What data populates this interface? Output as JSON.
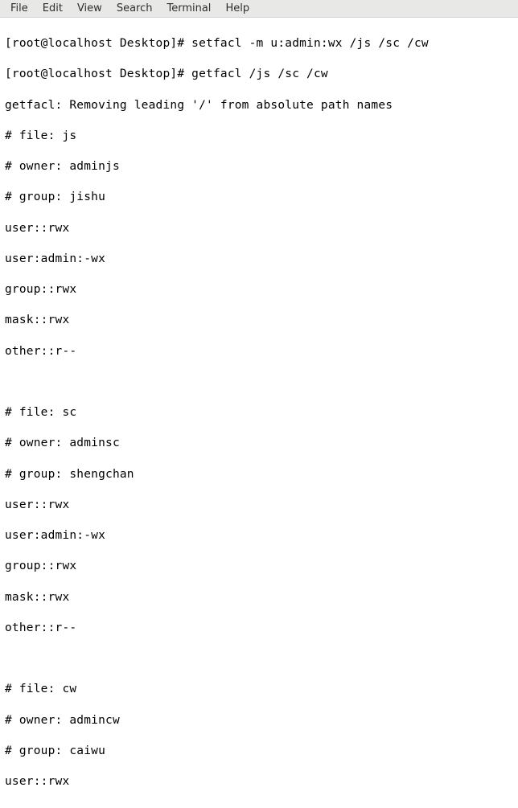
{
  "menu": {
    "file": "File",
    "edit": "Edit",
    "view": "View",
    "search": "Search",
    "terminal": "Terminal",
    "help": "Help"
  },
  "term": {
    "l01": "[root@localhost Desktop]# setfacl -m u:admin:wx /js /sc /cw",
    "l02": "[root@localhost Desktop]# getfacl /js /sc /cw",
    "l03": "getfacl: Removing leading '/' from absolute path names",
    "l04": "# file: js",
    "l05": "# owner: adminjs",
    "l06": "# group: jishu",
    "l07": "user::rwx",
    "l08": "user:admin:-wx",
    "l09": "group::rwx",
    "l10": "mask::rwx",
    "l11": "other::r--",
    "l12": " ",
    "l13": "# file: sc",
    "l14": "# owner: adminsc",
    "l15": "# group: shengchan",
    "l16": "user::rwx",
    "l17": "user:admin:-wx",
    "l18": "group::rwx",
    "l19": "mask::rwx",
    "l20": "other::r--",
    "l21": " ",
    "l22": "# file: cw",
    "l23": "# owner: admincw",
    "l24": "# group: caiwu",
    "l25": "user::rwx"
  }
}
